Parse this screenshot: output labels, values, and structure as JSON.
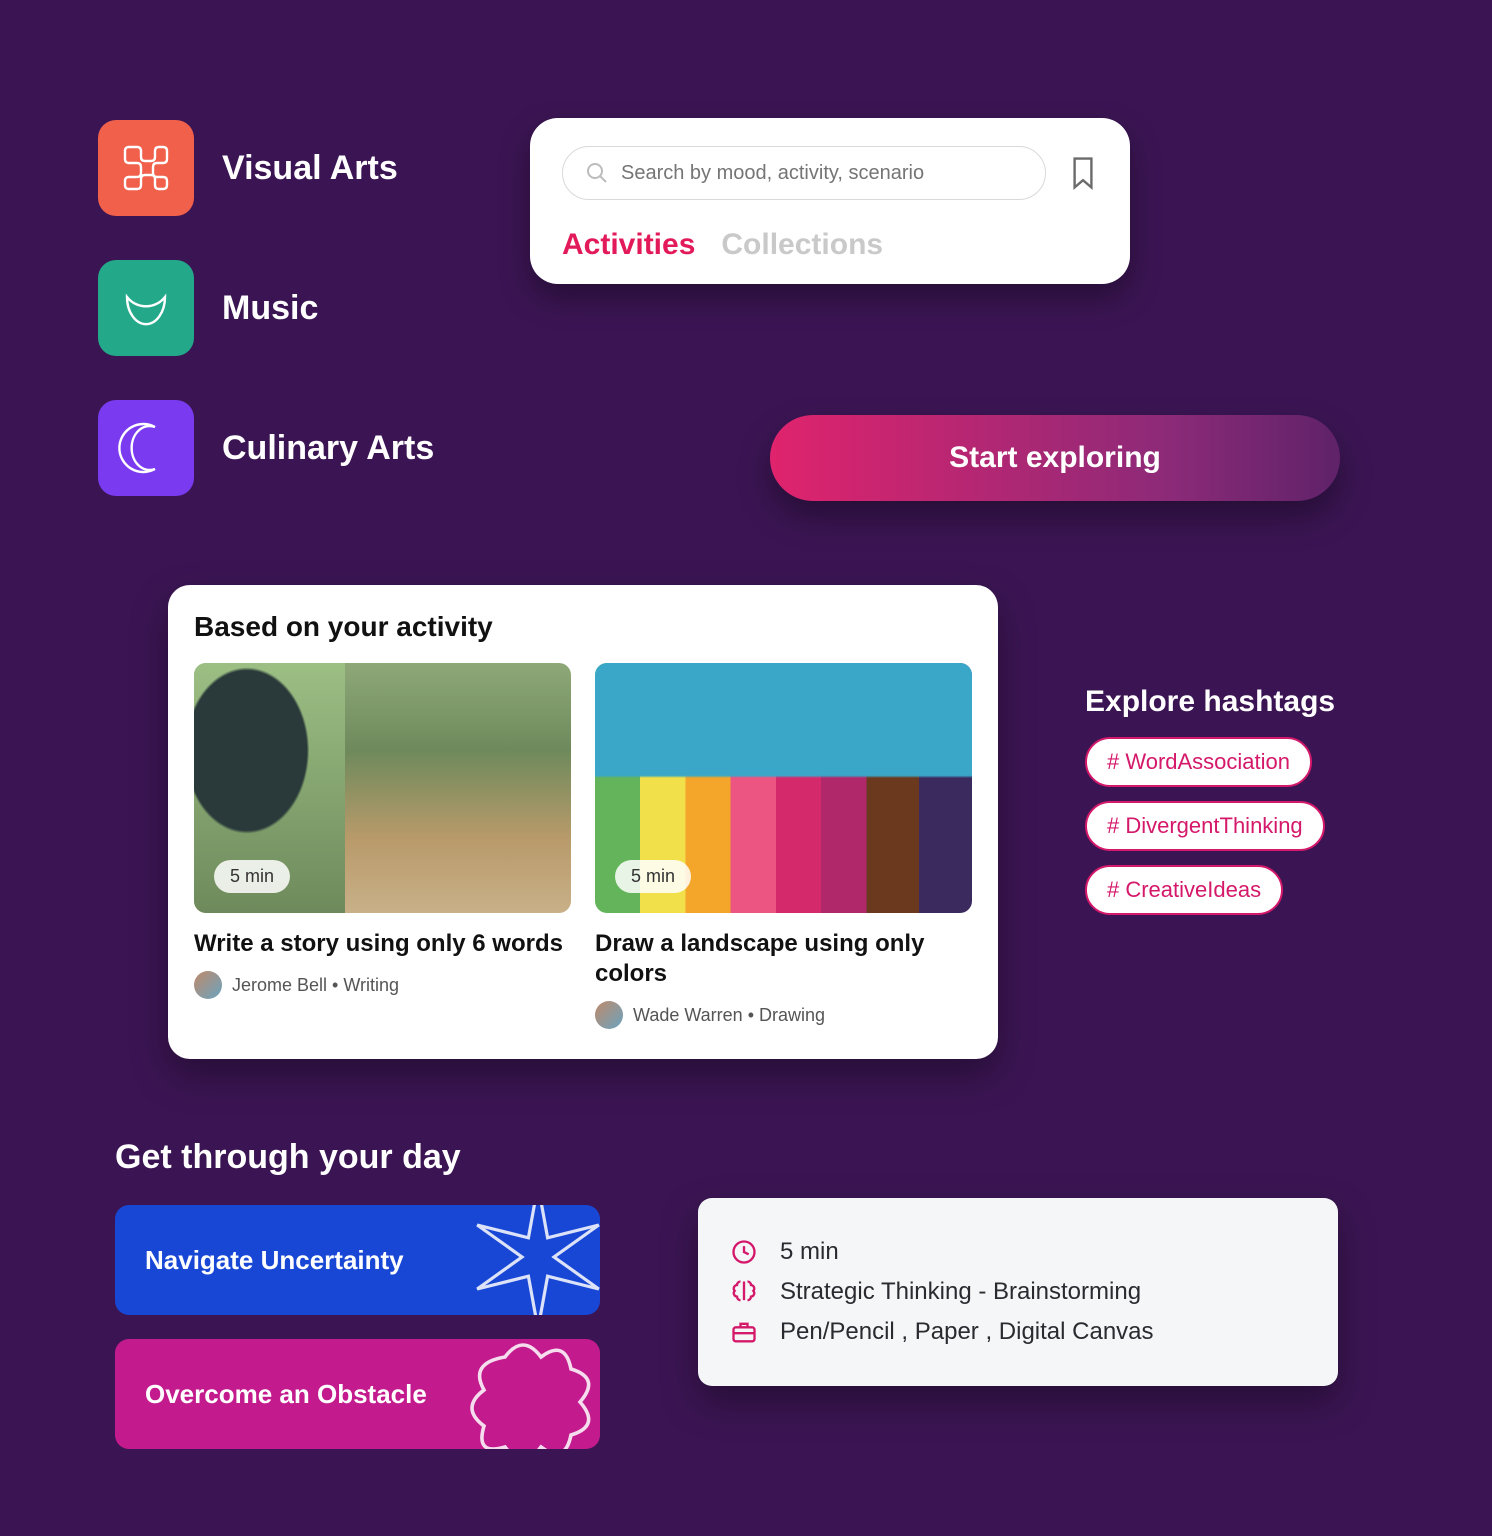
{
  "categories": [
    {
      "label": "Visual Arts",
      "color": "#f0604a",
      "icon": "visual-arts"
    },
    {
      "label": "Music",
      "color": "#23a98a",
      "icon": "music"
    },
    {
      "label": "Culinary Arts",
      "color": "#7a3bf0",
      "icon": "culinary"
    }
  ],
  "search": {
    "placeholder": "Search by mood, activity, scenario",
    "tabs": [
      {
        "label": "Activities",
        "active": true
      },
      {
        "label": "Collections",
        "active": false
      }
    ]
  },
  "cta_label": "Start exploring",
  "activity": {
    "heading": "Based on your activity",
    "items": [
      {
        "duration": "5 min",
        "title": "Write a story using only 6 words",
        "author": "Jerome Bell",
        "category": "Writing"
      },
      {
        "duration": "5 min",
        "title": "Draw a landscape using only colors",
        "author": "Wade Warren",
        "category": "Drawing"
      }
    ]
  },
  "hashtags": {
    "heading": "Explore hashtags",
    "tags": [
      "# WordAssociation",
      "# DivergentThinking",
      "# CreativeIdeas"
    ]
  },
  "day": {
    "heading": "Get through your day",
    "tiles": [
      "Navigate Uncertainty",
      "Overcome an Obstacle"
    ]
  },
  "details": {
    "duration": "5 min",
    "skill": "Strategic Thinking - Brainstorming",
    "tools": "Pen/Pencil , Paper , Digital Canvas"
  }
}
